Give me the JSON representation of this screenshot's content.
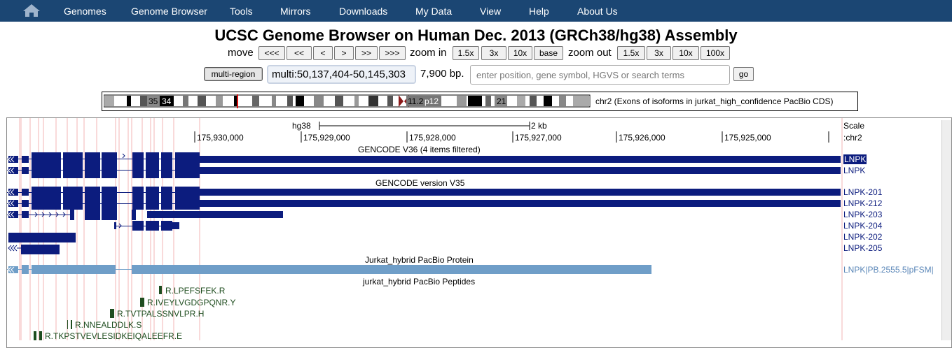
{
  "nav": {
    "home_icon": "home-icon",
    "items": [
      "Genomes",
      "Genome Browser",
      "Tools",
      "Mirrors",
      "Downloads",
      "My Data",
      "View",
      "Help",
      "About Us"
    ]
  },
  "title": "UCSC Genome Browser on Human Dec. 2013 (GRCh38/hg38) Assembly",
  "controls": {
    "move_label": "move",
    "move_buttons": [
      "<<<",
      "<<",
      "<",
      ">",
      ">>",
      ">>>"
    ],
    "zoom_in_label": "zoom in",
    "zoom_in_buttons": [
      "1.5x",
      "3x",
      "10x",
      "base"
    ],
    "zoom_out_label": "zoom out",
    "zoom_out_buttons": [
      "1.5x",
      "3x",
      "10x",
      "100x"
    ]
  },
  "position": {
    "multi_region_label": "multi-region",
    "value": "multi:50,137,404-50,145,303",
    "size": "7,900 bp.",
    "search_placeholder": "enter position, gene symbol, HGVS or search terms",
    "go_label": "go"
  },
  "ideogram": {
    "bands": [
      "35",
      "34",
      "11.2",
      "p12",
      "21"
    ],
    "caption": "chr2 (Exons of isoforms in jurkat_high_confidence PacBio CDS)"
  },
  "tracks": {
    "assembly": "hg38",
    "scale_value": "2 kb",
    "scale_label": "Scale",
    "chrom_label": ":chr2",
    "ticks": [
      "175,930,000",
      "175,929,000",
      "175,928,000",
      "175,927,000",
      "175,926,000",
      "175,925,000"
    ],
    "gencode_v36": {
      "title": "GENCODE V36 (4 items filtered)",
      "items": [
        "LNPK",
        "LNPK"
      ]
    },
    "gencode_v35": {
      "title": "GENCODE version V35",
      "items": [
        "LNPK-201",
        "LNPK-212",
        "LNPK-203",
        "LNPK-204",
        "LNPK-202",
        "LNPK-205"
      ]
    },
    "pacbio_protein": {
      "title": "Jurkat_hybrid PacBio Protein",
      "item": "LNPK|PB.2555.5|pFSM|"
    },
    "pacbio_peptides": {
      "title": "jurkat_hybrid PacBio Peptides",
      "items": [
        "R.LPEFSFEK.R",
        "R.IVEYLVGDGPQNR.Y",
        "R.TVTPALSSNVLPR.H",
        "R.NNEALDDLK.S",
        "R.TKPSTVEVLESIDKEIQALEEFR.E"
      ]
    }
  },
  "colors": {
    "nav_bg": "#1b4673",
    "gencode": "#0c1c7e",
    "pacbio_protein": "#6f9ec8",
    "peptide": "#1f4d1f",
    "selected_label_bg": "#0c1c7e"
  }
}
